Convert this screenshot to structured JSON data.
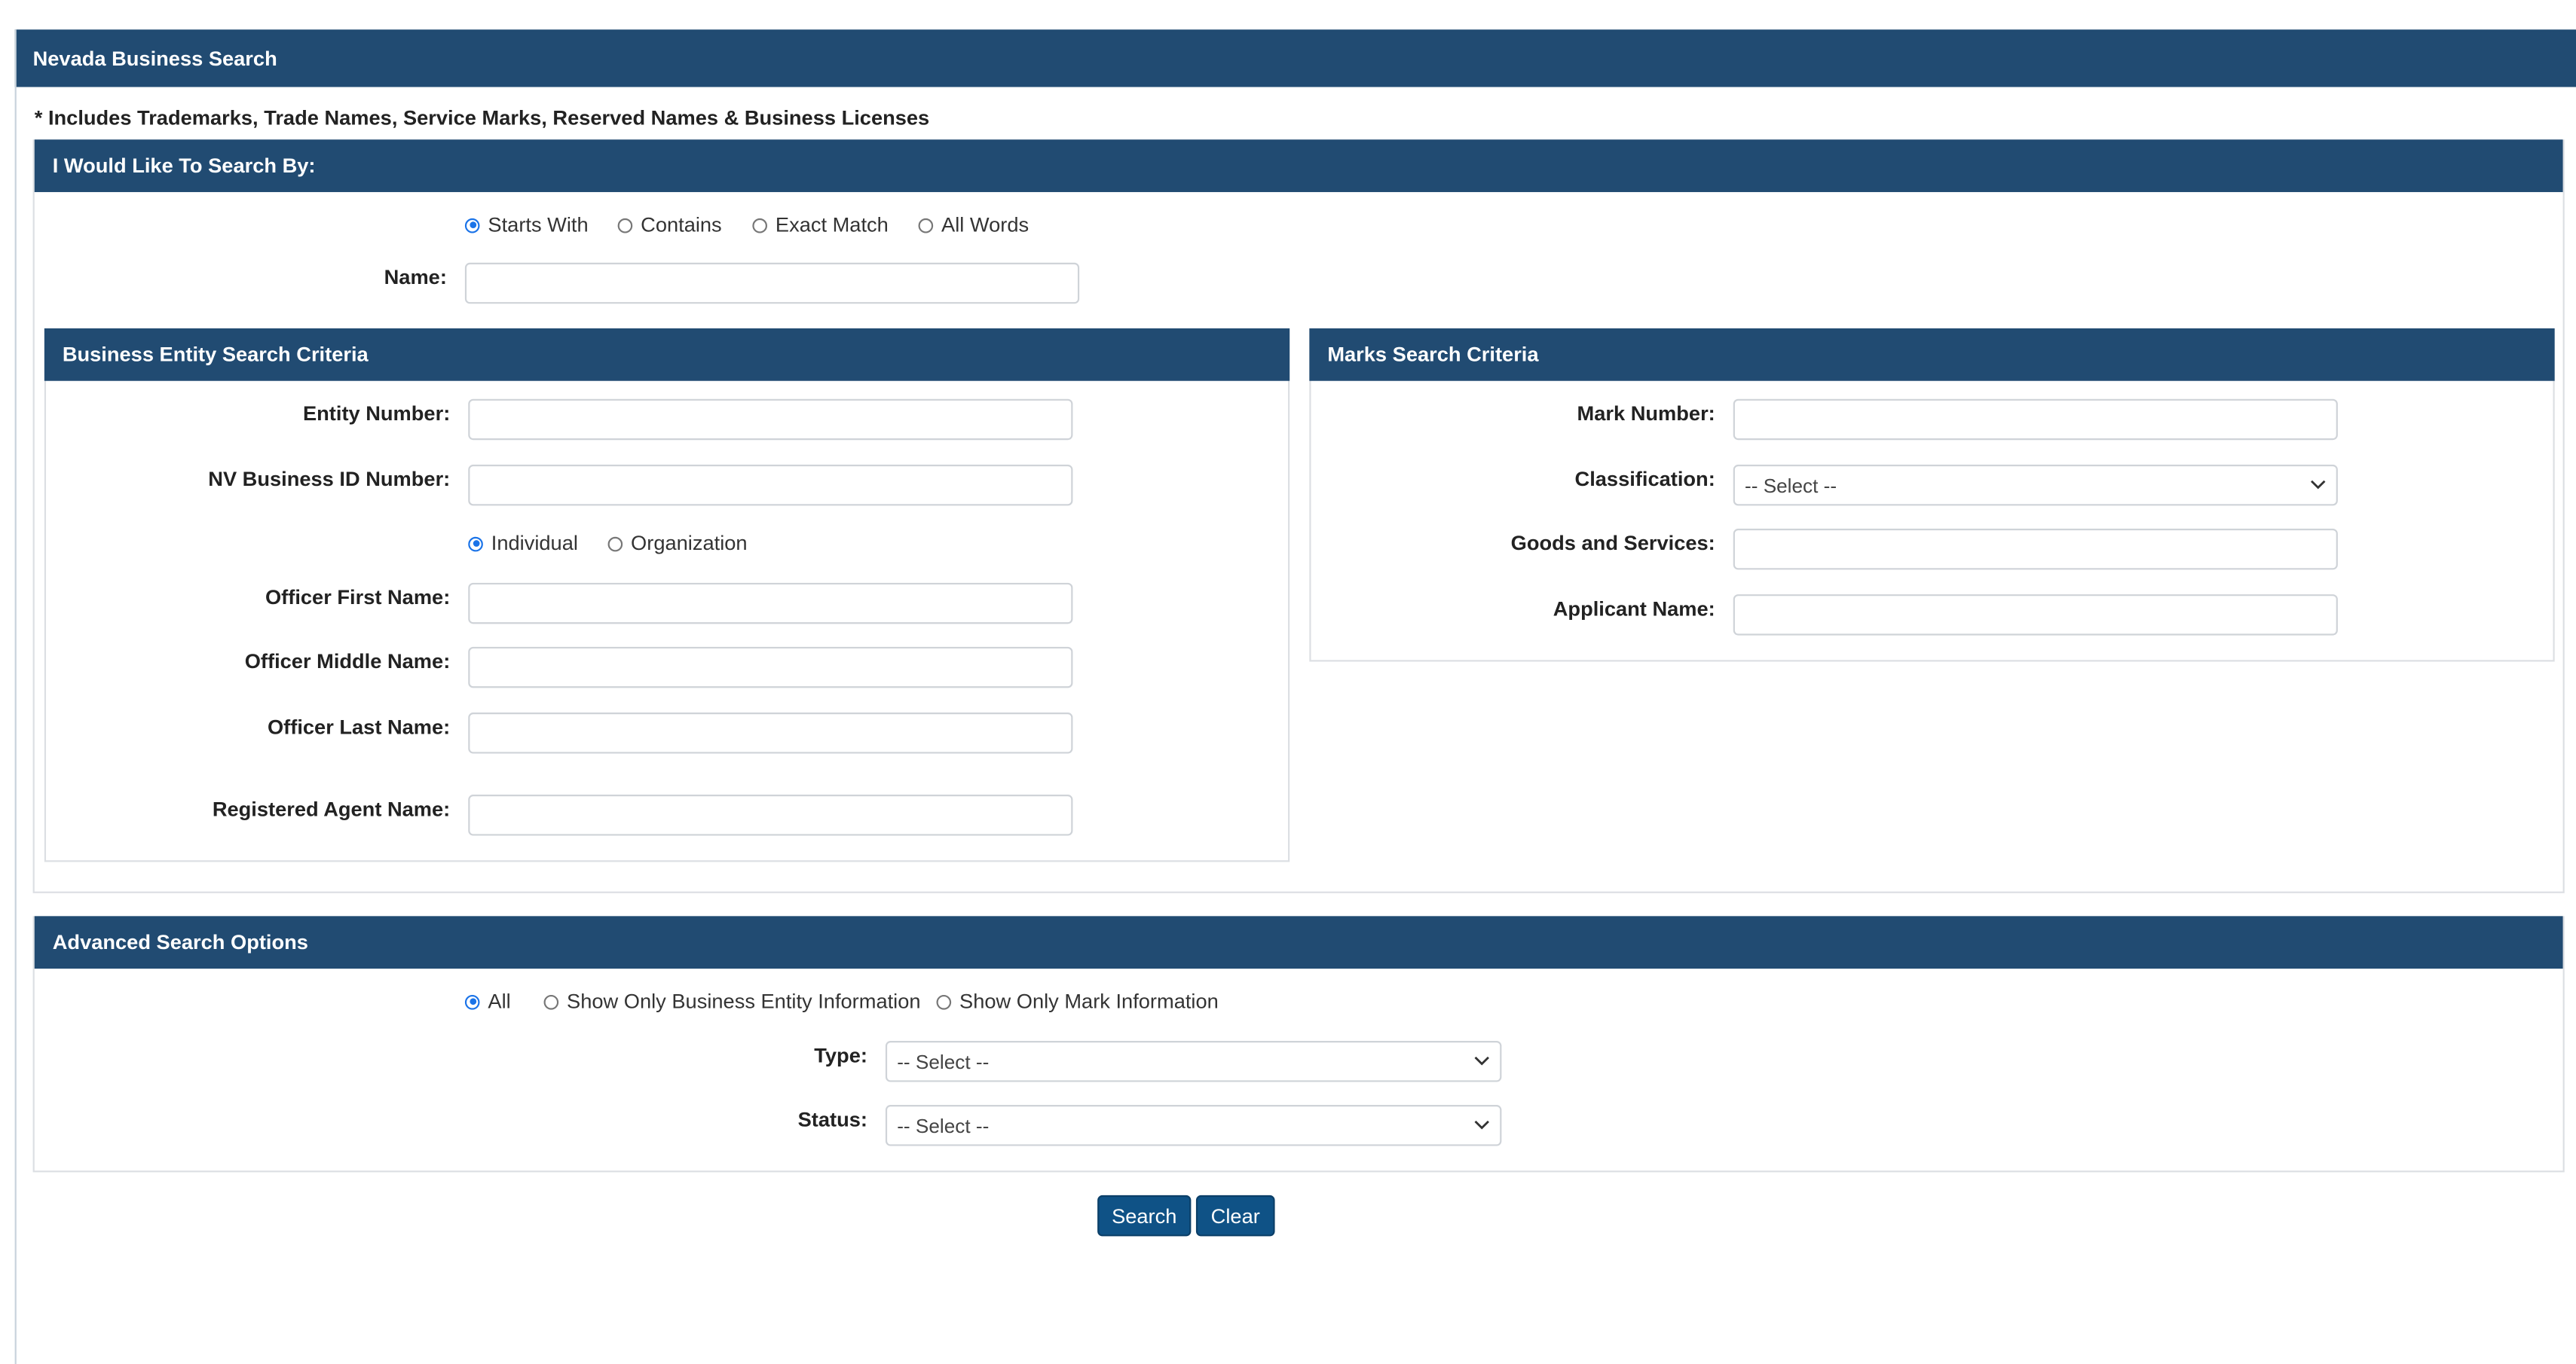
{
  "header": {
    "title": "Nevada Business Search"
  },
  "note": "* Includes Trademarks, Trade Names, Service Marks, Reserved Names & Business Licenses",
  "search_by": {
    "title": "I Would Like To Search By:",
    "modes": [
      {
        "label": "Starts With",
        "checked": true
      },
      {
        "label": "Contains",
        "checked": false
      },
      {
        "label": "Exact Match",
        "checked": false
      },
      {
        "label": "All Words",
        "checked": false
      }
    ],
    "name_label": "Name:",
    "name_value": ""
  },
  "entity": {
    "title": "Business Entity Search Criteria",
    "entity_number_label": "Entity Number:",
    "nv_id_label": "NV Business ID Number:",
    "officer_types": [
      {
        "label": "Individual",
        "checked": true
      },
      {
        "label": "Organization",
        "checked": false
      }
    ],
    "officer_first_label": "Officer First Name:",
    "officer_middle_label": "Officer Middle Name:",
    "officer_last_label": "Officer Last Name:",
    "agent_label": "Registered Agent Name:"
  },
  "marks": {
    "title": "Marks Search Criteria",
    "mark_number_label": "Mark Number:",
    "classification_label": "Classification:",
    "classification_value": "-- Select --",
    "goods_label": "Goods and Services:",
    "applicant_label": "Applicant Name:"
  },
  "advanced": {
    "title": "Advanced Search Options",
    "scopes": [
      {
        "label": "All",
        "checked": true
      },
      {
        "label": "Show Only Business Entity Information",
        "checked": false
      },
      {
        "label": "Show Only Mark Information",
        "checked": false
      }
    ],
    "type_label": "Type:",
    "type_value": "-- Select --",
    "status_label": "Status:",
    "status_value": "-- Select --"
  },
  "buttons": {
    "search": "Search",
    "clear": "Clear"
  },
  "colors": {
    "header_bg": "#214b72",
    "button_bg": "#0f5286",
    "radio_accent": "#1a73e8"
  },
  "icons": {
    "select_chevron": "chevron-down-icon"
  }
}
